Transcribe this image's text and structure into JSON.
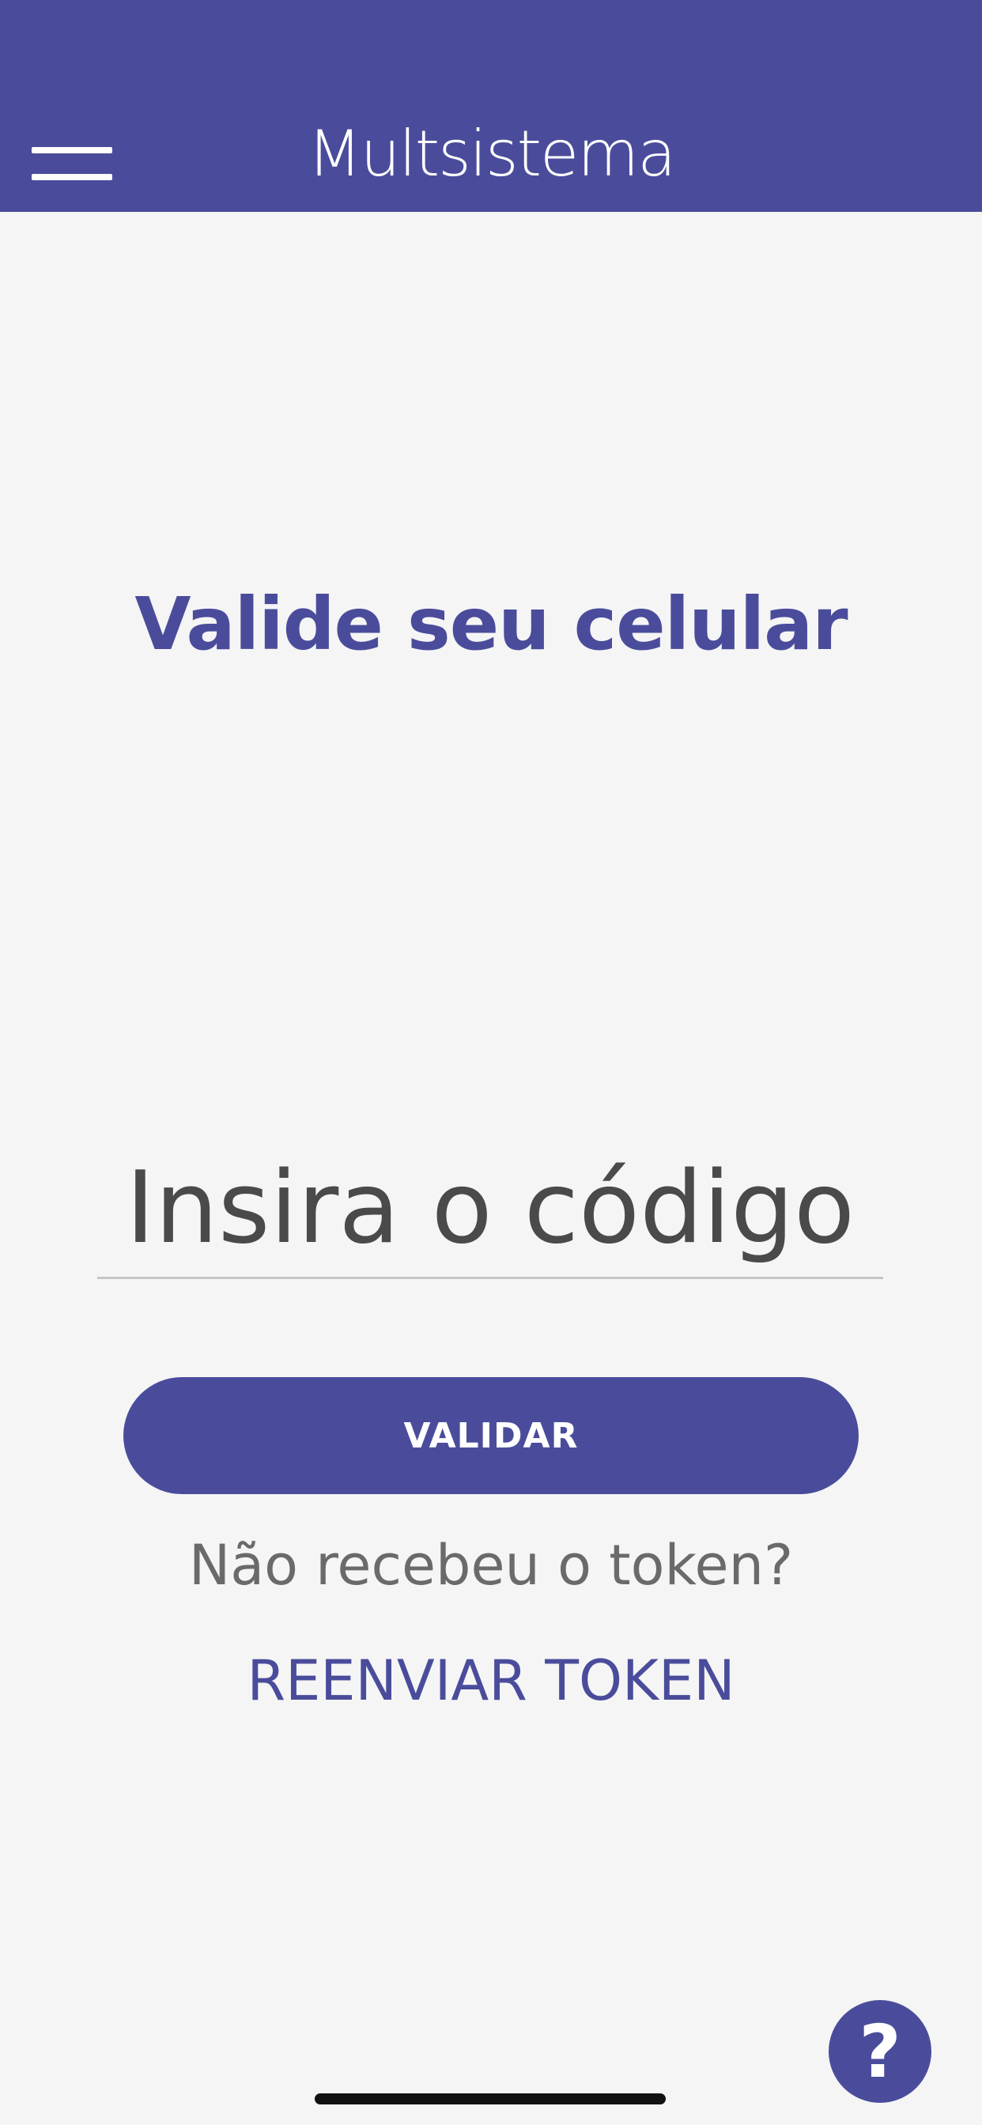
{
  "header": {
    "brand": "Multsistema",
    "background_color": "#4a4c9b",
    "menu_icon": "hamburger-menu-icon"
  },
  "main": {
    "title": "Valide seu celular",
    "code_input": {
      "placeholder": "Insira o código",
      "value": ""
    },
    "validate_label": "VALIDAR",
    "resend_prompt": "Não recebeu o token?",
    "resend_label": "REENVIAR TOKEN"
  },
  "help": {
    "label": "?",
    "icon": "help-icon"
  },
  "colors": {
    "accent": "#4a4c9b",
    "background": "#f5f5f5",
    "text": "#4a4a4a",
    "muted_text": "#6a6a6a"
  }
}
